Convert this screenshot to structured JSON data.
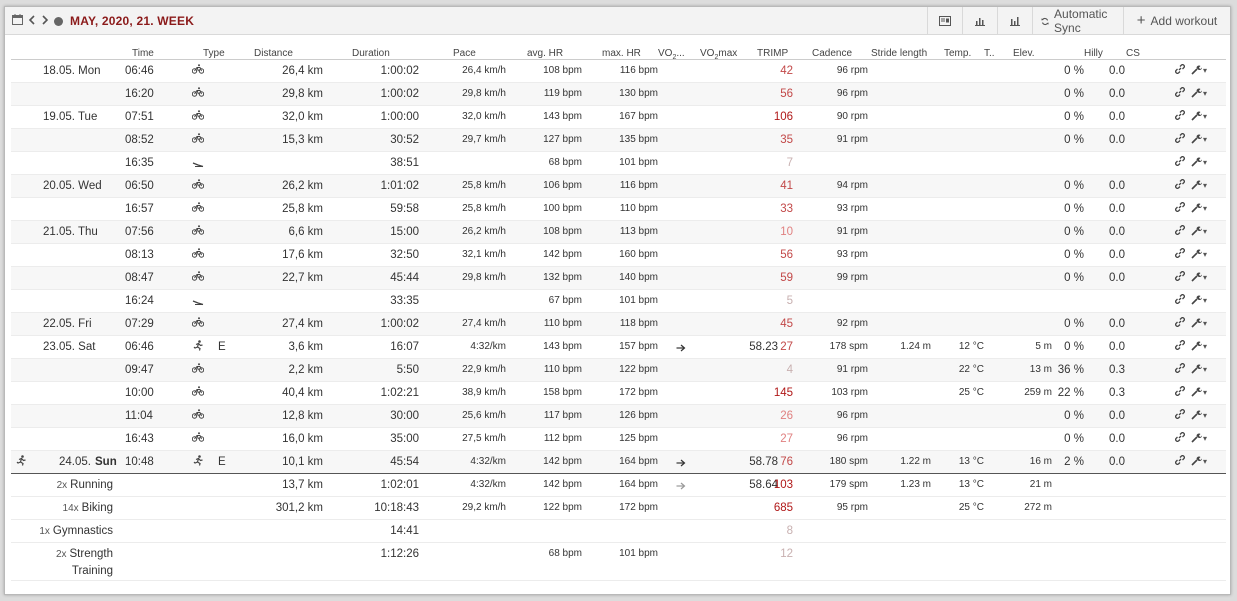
{
  "toolbar": {
    "title": "MAY, 2020, 21. WEEK",
    "sync_label": "Automatic Sync",
    "add_workout_label": "Add workout"
  },
  "columns": {
    "time": "Time",
    "type": "Type",
    "distance": "Distance",
    "duration": "Duration",
    "pace": "Pace",
    "avg_hr": "avg. HR",
    "max_hr": "max. HR",
    "vo2_pre": "VO",
    "vo2_post": "...",
    "vo2max_pre": "VO",
    "vo2max_post": "max",
    "trimp": "TRIMP",
    "cadence": "Cadence",
    "stride": "Stride length",
    "temp": "Temp.",
    "t": "T..",
    "elev": "Elev.",
    "hilly": "Hilly",
    "cs": "CS"
  },
  "rows": [
    {
      "date": "18.05. Mon",
      "time": "06:46",
      "type": "bike",
      "distance": "26,4 km",
      "duration": "1:00:02",
      "pace": "26,4 km/h",
      "avg_hr": "108 bpm",
      "max_hr": "116 bpm",
      "trimp": "42",
      "tl": 2,
      "cadence": "96 rpm",
      "hilly": "0 %",
      "cs": "0.0"
    },
    {
      "date": "",
      "time": "16:20",
      "type": "bike",
      "distance": "29,8 km",
      "duration": "1:00:02",
      "pace": "29,8 km/h",
      "avg_hr": "119 bpm",
      "max_hr": "130 bpm",
      "trimp": "56",
      "tl": 2,
      "cadence": "96 rpm",
      "hilly": "0 %",
      "cs": "0.0"
    },
    {
      "date": "19.05. Tue",
      "time": "07:51",
      "type": "bike",
      "distance": "32,0 km",
      "duration": "1:00:00",
      "pace": "32,0 km/h",
      "avg_hr": "143 bpm",
      "max_hr": "167 bpm",
      "trimp": "106",
      "tl": 3,
      "cadence": "90 rpm",
      "hilly": "0 %",
      "cs": "0.0"
    },
    {
      "date": "",
      "time": "08:52",
      "type": "bike",
      "distance": "15,3 km",
      "duration": "30:52",
      "pace": "29,7 km/h",
      "avg_hr": "127 bpm",
      "max_hr": "135 bpm",
      "trimp": "35",
      "tl": 2,
      "cadence": "91 rpm",
      "hilly": "0 %",
      "cs": "0.0"
    },
    {
      "date": "",
      "time": "16:35",
      "type": "strength",
      "distance": "",
      "duration": "38:51",
      "pace": "",
      "avg_hr": "68 bpm",
      "max_hr": "101 bpm",
      "trimp": "7",
      "tl": 0,
      "cadence": "",
      "hilly": "",
      "cs": ""
    },
    {
      "date": "20.05. Wed",
      "time": "06:50",
      "type": "bike",
      "distance": "26,2 km",
      "duration": "1:01:02",
      "pace": "25,8 km/h",
      "avg_hr": "106 bpm",
      "max_hr": "116 bpm",
      "trimp": "41",
      "tl": 2,
      "cadence": "94 rpm",
      "hilly": "0 %",
      "cs": "0.0"
    },
    {
      "date": "",
      "time": "16:57",
      "type": "bike",
      "distance": "25,8 km",
      "duration": "59:58",
      "pace": "25,8 km/h",
      "avg_hr": "100 bpm",
      "max_hr": "110 bpm",
      "trimp": "33",
      "tl": 2,
      "cadence": "93 rpm",
      "hilly": "0 %",
      "cs": "0.0"
    },
    {
      "date": "21.05. Thu",
      "time": "07:56",
      "type": "bike",
      "distance": "6,6 km",
      "duration": "15:00",
      "pace": "26,2 km/h",
      "avg_hr": "108 bpm",
      "max_hr": "113 bpm",
      "trimp": "10",
      "tl": 1,
      "cadence": "91 rpm",
      "hilly": "0 %",
      "cs": "0.0"
    },
    {
      "date": "",
      "time": "08:13",
      "type": "bike",
      "distance": "17,6 km",
      "duration": "32:50",
      "pace": "32,1 km/h",
      "avg_hr": "142 bpm",
      "max_hr": "160 bpm",
      "trimp": "56",
      "tl": 2,
      "cadence": "93 rpm",
      "hilly": "0 %",
      "cs": "0.0"
    },
    {
      "date": "",
      "time": "08:47",
      "type": "bike",
      "distance": "22,7 km",
      "duration": "45:44",
      "pace": "29,8 km/h",
      "avg_hr": "132 bpm",
      "max_hr": "140 bpm",
      "trimp": "59",
      "tl": 2,
      "cadence": "99 rpm",
      "hilly": "0 %",
      "cs": "0.0"
    },
    {
      "date": "",
      "time": "16:24",
      "type": "strength",
      "distance": "",
      "duration": "33:35",
      "pace": "",
      "avg_hr": "67 bpm",
      "max_hr": "101 bpm",
      "trimp": "5",
      "tl": 0,
      "cadence": "",
      "hilly": "",
      "cs": ""
    },
    {
      "date": "22.05. Fri",
      "time": "07:29",
      "type": "bike",
      "distance": "27,4 km",
      "duration": "1:00:02",
      "pace": "27,4 km/h",
      "avg_hr": "110 bpm",
      "max_hr": "118 bpm",
      "trimp": "45",
      "tl": 2,
      "cadence": "92 rpm",
      "hilly": "0 %",
      "cs": "0.0"
    },
    {
      "date": "23.05. Sat",
      "time": "06:46",
      "type": "run",
      "etype": "E",
      "distance": "3,6 km",
      "duration": "16:07",
      "pace": "4:32/km",
      "avg_hr": "143 bpm",
      "max_hr": "157 bpm",
      "vo2": "→",
      "vo2max": "58.23",
      "trimp": "27",
      "tl": 2,
      "cadence": "178 spm",
      "stride": "1.24 m",
      "temp": "12 °C",
      "elev": "5 m",
      "hilly": "0 %",
      "cs": "0.0"
    },
    {
      "date": "",
      "time": "09:47",
      "type": "bike",
      "distance": "2,2 km",
      "duration": "5:50",
      "pace": "22,9 km/h",
      "avg_hr": "110 bpm",
      "max_hr": "122 bpm",
      "trimp": "4",
      "tl": 0,
      "cadence": "91 rpm",
      "temp": "22 °C",
      "elev": "13 m",
      "hilly": "36 %",
      "cs": "0.3"
    },
    {
      "date": "",
      "time": "10:00",
      "type": "bike",
      "distance": "40,4 km",
      "duration": "1:02:21",
      "pace": "38,9 km/h",
      "avg_hr": "158 bpm",
      "max_hr": "172 bpm",
      "trimp": "145",
      "tl": 3,
      "cadence": "103 rpm",
      "temp": "25 °C",
      "elev": "259 m",
      "hilly": "22 %",
      "cs": "0.3"
    },
    {
      "date": "",
      "time": "11:04",
      "type": "bike",
      "distance": "12,8 km",
      "duration": "30:00",
      "pace": "25,6 km/h",
      "avg_hr": "117 bpm",
      "max_hr": "126 bpm",
      "trimp": "26",
      "tl": 1,
      "cadence": "96 rpm",
      "hilly": "0 %",
      "cs": "0.0"
    },
    {
      "date": "",
      "time": "16:43",
      "type": "bike",
      "distance": "16,0 km",
      "duration": "35:00",
      "pace": "27,5 km/h",
      "avg_hr": "112 bpm",
      "max_hr": "125 bpm",
      "trimp": "27",
      "tl": 1,
      "cadence": "96 rpm",
      "hilly": "0 %",
      "cs": "0.0"
    },
    {
      "date": "24.05.",
      "date_bold": "Sun",
      "time": "10:48",
      "type": "run",
      "etype": "E",
      "distance": "10,1 km",
      "duration": "45:54",
      "pace": "4:32/km",
      "avg_hr": "142 bpm",
      "max_hr": "164 bpm",
      "vo2": "→",
      "vo2max": "58.78",
      "trimp": "76",
      "tl": 2,
      "cadence": "180 spm",
      "stride": "1.22 m",
      "temp": "13 °C",
      "elev": "16 m",
      "hilly": "2 %",
      "cs": "0.0"
    }
  ],
  "summary": [
    {
      "mult": "2x",
      "label": "Running",
      "distance": "13,7 km",
      "duration": "1:02:01",
      "pace": "4:32/km",
      "avg_hr": "142 bpm",
      "max_hr": "164 bpm",
      "vo2": "→",
      "vo2max": "58.64",
      "trimp": "103",
      "tl": 3,
      "cadence": "179 spm",
      "stride": "1.23 m",
      "temp": "13 °C",
      "elev": "21 m"
    },
    {
      "mult": "14x",
      "label": "Biking",
      "distance": "301,2 km",
      "duration": "10:18:43",
      "pace": "29,2 km/h",
      "avg_hr": "122 bpm",
      "max_hr": "172 bpm",
      "trimp": "685",
      "tl": 3,
      "cadence": "95 rpm",
      "temp": "25 °C",
      "elev": "272 m"
    },
    {
      "mult": "1x",
      "label": "Gymnastics",
      "duration": "14:41",
      "trimp": "8",
      "tl": 0
    },
    {
      "mult": "2x",
      "label": "Strength",
      "label2": "Training",
      "duration": "1:12:26",
      "avg_hr": "68 bpm",
      "max_hr": "101 bpm",
      "trimp": "12",
      "tl": 0
    }
  ]
}
